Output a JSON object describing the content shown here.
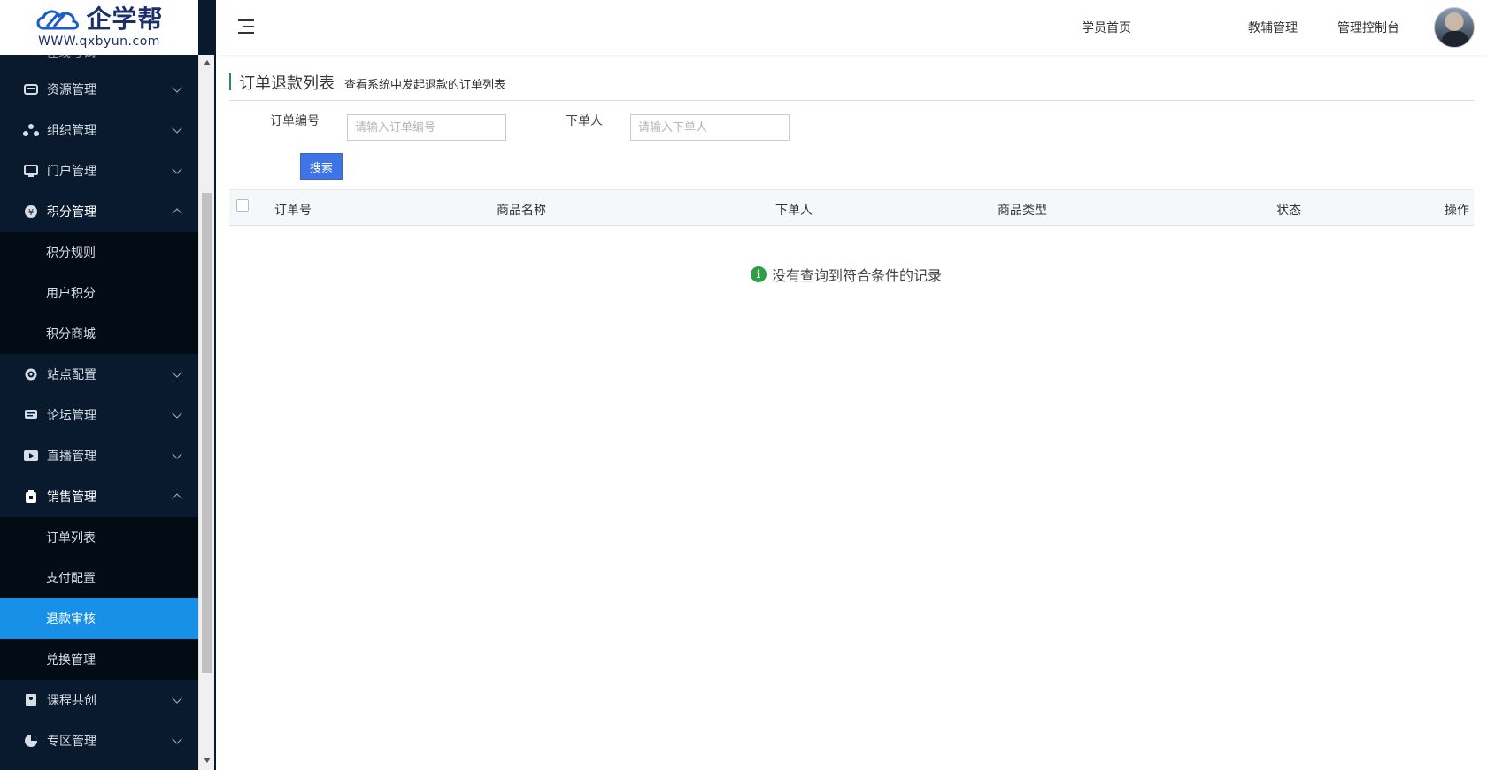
{
  "logo": {
    "name": "企学帮",
    "url": "WWW.qxbyun.com"
  },
  "sidebar": {
    "partial_item": "在线考试",
    "menu": [
      {
        "label": "资源管理",
        "icon": "database-icon",
        "top": 0
      },
      {
        "label": "组织管理",
        "icon": "org-icon"
      },
      {
        "label": "门户管理",
        "icon": "monitor-icon"
      },
      {
        "label": "积分管理",
        "icon": "points-icon"
      },
      {
        "label": "站点配置",
        "icon": "site-config-icon"
      },
      {
        "label": "论坛管理",
        "icon": "forum-icon"
      },
      {
        "label": "直播管理",
        "icon": "live-icon"
      },
      {
        "label": "销售管理",
        "icon": "sales-icon"
      },
      {
        "label": "课程共创",
        "icon": "course-icon"
      },
      {
        "label": "专区管理",
        "icon": "zone-icon"
      }
    ],
    "points_sub": [
      "积分规则",
      "用户积分",
      "积分商城"
    ],
    "sales_sub": [
      "订单列表",
      "支付配置",
      "退款审核",
      "兑换管理"
    ]
  },
  "header": {
    "nav": [
      "学员首页",
      "教辅管理",
      "管理控制台"
    ]
  },
  "page": {
    "title": "订单退款列表",
    "description": "查看系统中发起退款的订单列表"
  },
  "filters": {
    "order_no_label": "订单编号",
    "order_no_placeholder": "请输入订单编号",
    "buyer_label": "下单人",
    "buyer_placeholder": "请输入下单人",
    "search_button": "搜索"
  },
  "table": {
    "columns": [
      "订单号",
      "商品名称",
      "下单人",
      "商品类型",
      "状态",
      "操作"
    ],
    "empty_text": "没有查询到符合条件的记录"
  }
}
